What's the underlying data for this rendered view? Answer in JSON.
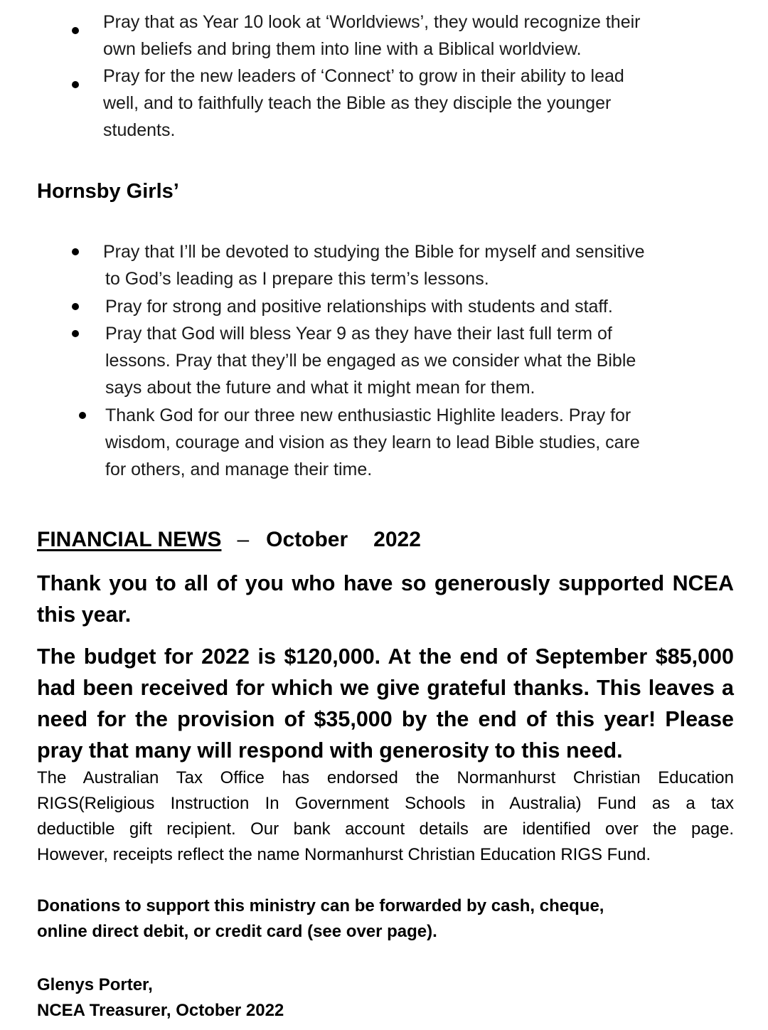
{
  "top_bullets": [
    {
      "lines": [
        "Pray that as Year 10 look at ‘Worldviews’, they would recognize their",
        "own beliefs and bring them into line with a Biblical worldview."
      ]
    },
    {
      "lines": [
        "Pray for the new leaders of ‘Connect’ to grow in their ability to lead",
        "well, and to faithfully teach the Bible as they disciple the younger",
        "students."
      ]
    }
  ],
  "hornsby": {
    "heading": "Hornsby Girls’",
    "bullets": [
      {
        "lines": [
          "Pray that I’ll be devoted to studying the Bible for myself and sensitive",
          "to God’s leading as I prepare this term’s lessons."
        ]
      },
      {
        "lines": [
          "Pray for strong and positive relationships with students and staff."
        ]
      },
      {
        "lines": [
          "Pray that God will bless Year 9 as they have their last full term of",
          "lessons. Pray that they’ll be engaged as we consider what the Bible",
          "says about the future and what it might mean for them."
        ]
      },
      {
        "lines": [
          "Thank God for our three new enthusiastic Highlite leaders. Pray for",
          "wisdom, courage and vision as they learn to lead Bible studies, care",
          "for others, and manage their time."
        ]
      }
    ]
  },
  "financial": {
    "title": "FINANCIAL NEWS",
    "dash": "–",
    "month": "October",
    "year": "2022",
    "thanks_lines": [
      "Thank you to all of you who have so generously supported NCEA",
      "this year."
    ],
    "budget_lines": [
      "The budget for 2022 is $120,000. At the end of September $85,000",
      "had been received for which we give grateful thanks. This leaves a",
      "need for the provision of $35,000 by the end of this year! Please",
      "pray that many will respond with generosity to this need."
    ],
    "tax_lines": [
      "The Australian Tax Office has endorsed the Normanhurst Christian Education",
      "RIGS(Religious Instruction In Government Schools in Australia) Fund as a tax",
      "deductible gift recipient. Our bank account details are identified over the page.",
      "However, receipts reflect the name Normanhurst Christian Education RIGS Fund."
    ],
    "donation_lines": [
      "Donations to support this ministry can be forwarded by cash, cheque,",
      "online direct debit, or credit card (see over page)."
    ],
    "signature_name": "Glenys Porter,",
    "signature_role": "NCEA Treasurer, October 2022"
  }
}
